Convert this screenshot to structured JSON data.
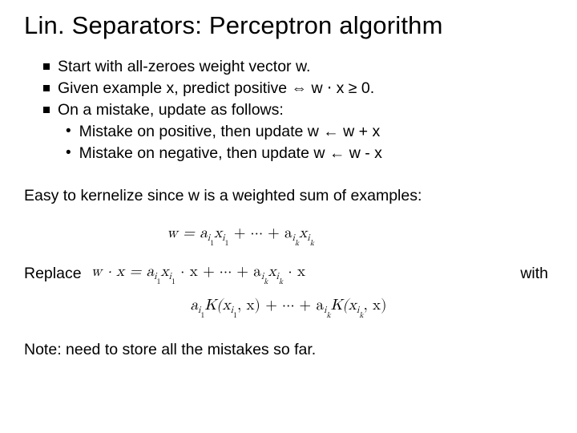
{
  "title": "Lin. Separators: Perceptron algorithm",
  "bullets": {
    "b1": "Start with all-zeroes weight vector w.",
    "b2": "Given  example x, predict positive ⇔ w ⋅ x ≥ 0.",
    "b3": "On a mistake, update as follows:",
    "b3a": "Mistake on positive, then update w ← w + x",
    "b3b": "Mistake on negative, then update w ← w - x"
  },
  "kernelize_line": "Easy to kernelize since w is a weighted sum of examples:",
  "replace_label": "Replace",
  "with_label": "with",
  "note_line": "Note: need to store all the mistakes so far.",
  "math": {
    "w_sum_prefix": "w = a",
    "i1": "i",
    "one": "1",
    "x": "x",
    "plus_dots": " + ⋯ + a",
    "k": "k",
    "wdotx": "w ⋅ x = a",
    "cdot_x_plus": " ⋅ x + ⋯ + a",
    "cdot_x_end": " ⋅ x",
    "K_open": "K(x",
    "comma_x_close": ", x) + ⋯ + a",
    "comma_x_close2": ", x)",
    "a": "a"
  }
}
